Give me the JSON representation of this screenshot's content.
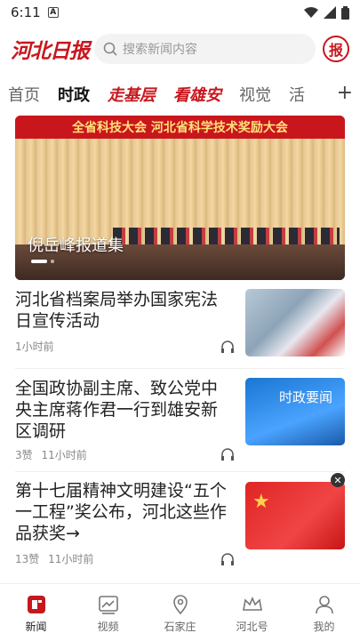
{
  "status": {
    "time": "6:11",
    "badge": "A"
  },
  "header": {
    "logo_text": "河北日报",
    "search_placeholder": "搜索新闻内容",
    "bao_label": "报"
  },
  "tabs": [
    {
      "label": "首页",
      "style": "normal"
    },
    {
      "label": "时政",
      "style": "active"
    },
    {
      "label": "走基层",
      "style": "red"
    },
    {
      "label": "看雄安",
      "style": "red"
    },
    {
      "label": "视觉",
      "style": "normal"
    },
    {
      "label": "活",
      "style": "normal"
    }
  ],
  "tabs_more": "+",
  "banner": {
    "stage_text": "全省科技大会  河北省科学技术奖励大会",
    "caption": "倪岳峰报道集"
  },
  "news": [
    {
      "title": "河北省档案局举办国家宪法日宣传活动",
      "likes": "",
      "time": "1小时前"
    },
    {
      "title": "全国政协副主席、致公党中央主席蒋作君一行到雄安新区调研",
      "likes": "3赞",
      "time": "11小时前",
      "thumb_text": "时政要闻"
    },
    {
      "title": "第十七届精神文明建设“五个一工程”奖公布，河北这些作品获奖→",
      "likes": "13赞",
      "time": "11小时前"
    }
  ],
  "bottom_nav": [
    {
      "label": "新闻",
      "icon": "news-icon",
      "active": true
    },
    {
      "label": "视频",
      "icon": "video-icon",
      "active": false
    },
    {
      "label": "石家庄",
      "icon": "location-icon",
      "active": false
    },
    {
      "label": "河北号",
      "icon": "crown-icon",
      "active": false
    },
    {
      "label": "我的",
      "icon": "profile-icon",
      "active": false
    }
  ],
  "colors": {
    "brand_red": "#c8161d"
  }
}
